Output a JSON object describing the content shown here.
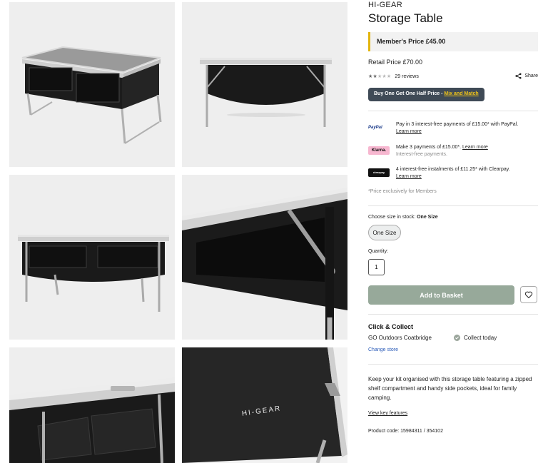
{
  "product": {
    "brand": "HI-GEAR",
    "title": "Storage Table",
    "member_price": "Member's Price £45.00",
    "retail_price": "Retail Price £70.00",
    "rating": 2.5,
    "rating_max": 5,
    "reviews": "29 reviews",
    "share_label": "Share",
    "promo_text": "Buy One Get One Half Price - ",
    "promo_link": "Mix and Match",
    "accent_color": "#e3b50f",
    "product_code": "Product code: 15984311 / 354102"
  },
  "payments": [
    {
      "logo": "PayPal",
      "text": "Pay in 3 interest-free payments of £15.00* with PayPal.",
      "link": "Learn more",
      "sub": ""
    },
    {
      "logo": "Klarna.",
      "text": "Make 3 payments of £15.00*.",
      "link": "Learn more",
      "sub": "Interest-free payments."
    },
    {
      "logo": "clearpay",
      "text": "4 interest-free instalments of £11.25* with Clearpay.",
      "link": "Learn more",
      "sub": ""
    }
  ],
  "price_note": "*Price exclusively for Members",
  "size": {
    "label": "Choose size in stock:",
    "selected": "One Size",
    "options": [
      "One Size"
    ]
  },
  "quantity": {
    "label": "Quantity:",
    "value": "1"
  },
  "basket_button": "Add to Basket",
  "basket_color": "#97a99a",
  "collect": {
    "title": "Click & Collect",
    "store": "GO Outdoors Coatbridge",
    "status": "Collect today",
    "change": "Change store"
  },
  "description": "Keep your kit organised with this storage table featuring a zipped shelf compartment and handy side pockets, ideal for family camping.",
  "features_link": "View key features",
  "gallery": [
    {
      "name": "table-angle-view"
    },
    {
      "name": "table-side-view"
    },
    {
      "name": "table-front-view"
    },
    {
      "name": "shelf-closeup"
    },
    {
      "name": "side-pockets-closeup"
    },
    {
      "name": "tabletop-logo-closeup",
      "logo_text": "HI-GEAR"
    }
  ]
}
